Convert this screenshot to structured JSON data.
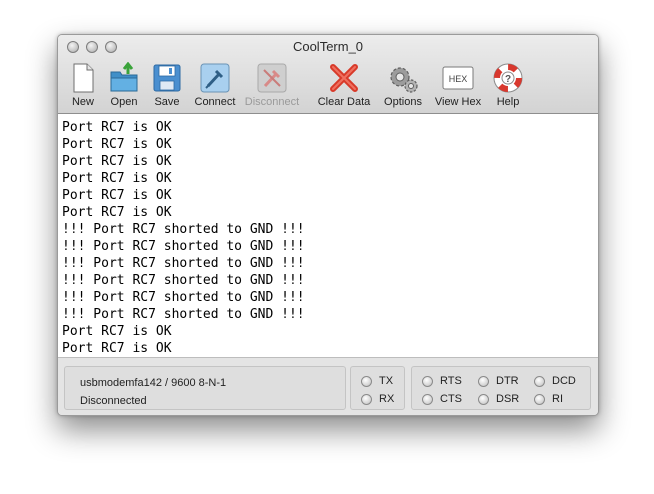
{
  "window": {
    "title": "CoolTerm_0"
  },
  "toolbar": {
    "new": "New",
    "open": "Open",
    "save": "Save",
    "connect": "Connect",
    "disconnect": "Disconnect",
    "clear_data": "Clear Data",
    "options": "Options",
    "view_hex": "View Hex",
    "view_hex_icon_text": "HEX",
    "help": "Help"
  },
  "terminal": {
    "lines": [
      "Port RC7 is OK",
      "Port RC7 is OK",
      "Port RC7 is OK",
      "Port RC7 is OK",
      "Port RC7 is OK",
      "Port RC7 is OK",
      "!!! Port RC7 shorted to GND !!!",
      "!!! Port RC7 shorted to GND !!!",
      "!!! Port RC7 shorted to GND !!!",
      "!!! Port RC7 shorted to GND !!!",
      "!!! Port RC7 shorted to GND !!!",
      "!!! Port RC7 shorted to GND !!!",
      "Port RC7 is OK",
      "Port RC7 is OK"
    ]
  },
  "status": {
    "port_settings": "usbmodemfa142 / 9600 8-N-1",
    "connection": "Disconnected",
    "tx": "TX",
    "rx": "RX",
    "rts": "RTS",
    "cts": "CTS",
    "dtr": "DTR",
    "dsr": "DSR",
    "dcd": "DCD",
    "ri": "RI"
  },
  "colors": {
    "clear_red": "#d83a2a",
    "help_red": "#d8382e",
    "disconnect_disabled": "#d88a88",
    "connect_blue": "#5aa0d8"
  }
}
